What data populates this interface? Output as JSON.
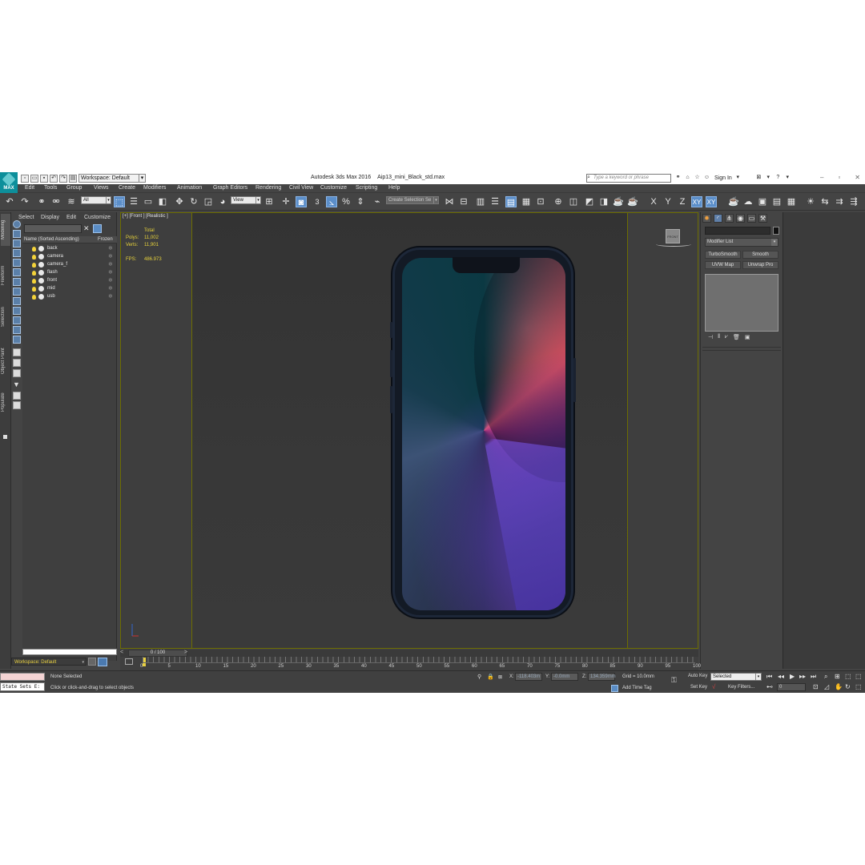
{
  "app": {
    "logo": "MAX",
    "title_app": "Autodesk 3ds Max 2016",
    "title_file": "Aip13_mini_Black_std.max",
    "workspace": "Workspace: Default",
    "search_placeholder": "Type a keyword or phrase",
    "sign_in": "Sign In"
  },
  "menu": [
    "Edit",
    "Tools",
    "Group",
    "Views",
    "Create",
    "Modifiers",
    "Animation",
    "Graph Editors",
    "Rendering",
    "Civil View",
    "Customize",
    "Scripting",
    "Help"
  ],
  "toolbar": {
    "filter_value": "All",
    "refcoord_value": "View",
    "selection_set_placeholder": "Create Selection Se",
    "snap_label": "3",
    "axis_x": "X",
    "axis_y": "Y",
    "axis_z": "Z",
    "axis_xy": "XY",
    "axis_xy2": "XY"
  },
  "sidepanel": {
    "tabs": [
      "Modeling",
      "Freeform",
      "Selection",
      "Object Paint",
      "Populate"
    ]
  },
  "explorer": {
    "tabs": [
      "Select",
      "Display",
      "Edit",
      "Customize"
    ],
    "col_name": "Name (Sorted Ascending)",
    "col_frozen": "Frozen",
    "items": [
      {
        "name": "back"
      },
      {
        "name": "camera"
      },
      {
        "name": "camera_f"
      },
      {
        "name": "flash"
      },
      {
        "name": "front"
      },
      {
        "name": "mid"
      },
      {
        "name": "usb"
      }
    ]
  },
  "viewport": {
    "label": "[+] [Front ] [Realistic ]",
    "stats_total": "Total",
    "polys_label": "Polys:",
    "polys_value": "11,002",
    "verts_label": "Verts:",
    "verts_value": "11,901",
    "fps_label": "FPS:",
    "fps_value": "486.973",
    "viewcube": "FRONT"
  },
  "command_panel": {
    "modifier_list": "Modifier List",
    "buttons": [
      "TurboSmooth",
      "Smooth",
      "UVW Map",
      "Unwrap Pro"
    ]
  },
  "timeline": {
    "slider": "0 / 100",
    "ticks": [
      "0",
      "5",
      "10",
      "15",
      "20",
      "25",
      "30",
      "35",
      "40",
      "45",
      "50",
      "55",
      "60",
      "65",
      "70",
      "75",
      "80",
      "85",
      "90",
      "95",
      "100"
    ]
  },
  "status": {
    "state_sets": "State Sets E:",
    "selection": "None Selected",
    "prompt": "Click or click-and-drag to select objects",
    "x_label": "X:",
    "x_value": "-118.403m",
    "y_label": "Y:",
    "y_value": "-0.0mm",
    "z_label": "Z:",
    "z_value": "134.359mm",
    "grid": "Grid = 10.0mm",
    "add_time_tag": "Add Time Tag",
    "auto_key": "Auto Key",
    "set_key": "Set Key",
    "selected": "Selected",
    "key_filters": "Key Filters...",
    "frame": "0"
  }
}
